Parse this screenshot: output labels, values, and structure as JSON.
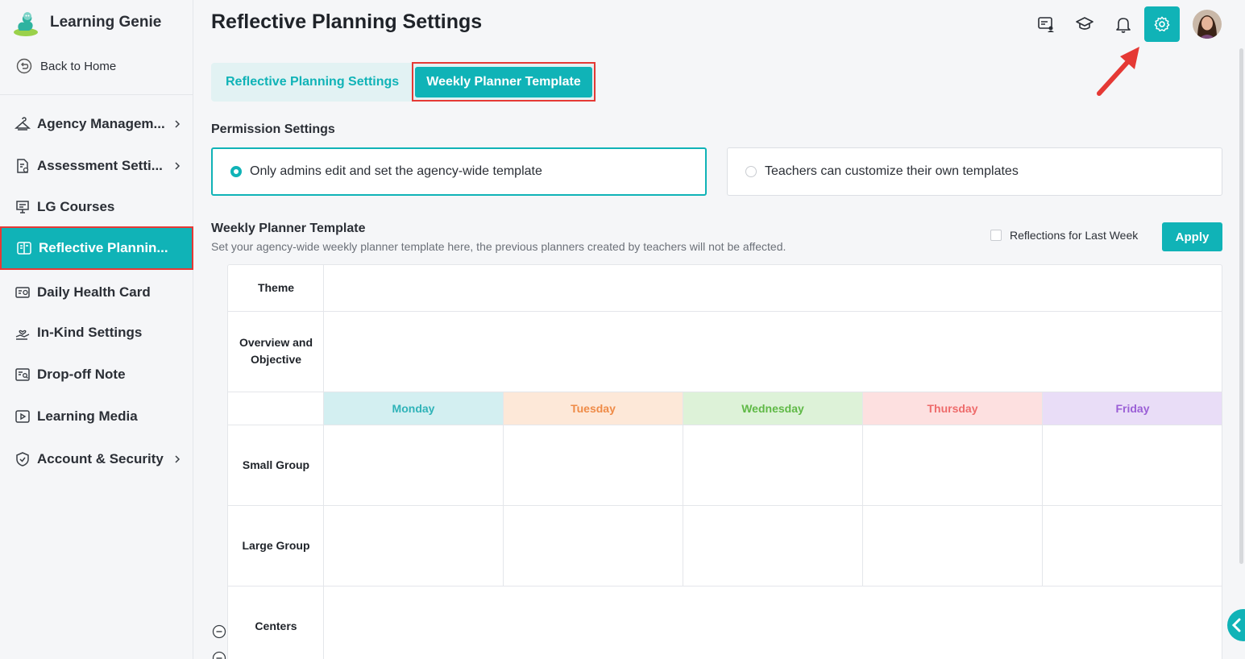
{
  "app": {
    "name": "Learning Genie"
  },
  "sidebar": {
    "back_label": "Back to Home",
    "items": [
      {
        "label": "Agency Managem...",
        "icon": "hanger-icon",
        "has_chevron": true
      },
      {
        "label": "Assessment Setti...",
        "icon": "document-settings-icon",
        "has_chevron": true
      },
      {
        "label": "LG Courses",
        "icon": "presentation-board-icon",
        "has_chevron": false
      },
      {
        "label": "Reflective Plannin...",
        "icon": "book-open-icon",
        "has_chevron": false,
        "active": true
      },
      {
        "label": "Daily Health Card",
        "icon": "health-card-icon",
        "has_chevron": false
      },
      {
        "label": "In-Kind Settings",
        "icon": "hand-heart-icon",
        "has_chevron": false
      },
      {
        "label": "Drop-off Note",
        "icon": "note-search-icon",
        "has_chevron": false
      },
      {
        "label": "Learning Media",
        "icon": "video-play-icon",
        "has_chevron": false
      },
      {
        "label": "Account & Security",
        "icon": "shield-icon",
        "has_chevron": true
      }
    ]
  },
  "header": {
    "title": "Reflective Planning Settings",
    "icons": [
      "chat-user-icon",
      "graduation-cap-icon",
      "bell-icon",
      "gear-icon",
      "avatar"
    ]
  },
  "tabs": {
    "items": [
      "Reflective Planning Settings",
      "Weekly Planner Template"
    ],
    "active_index": 1
  },
  "permission": {
    "title": "Permission Settings",
    "options": [
      {
        "label": "Only admins edit and set the agency-wide template",
        "selected": true
      },
      {
        "label": "Teachers can customize their own templates",
        "selected": false
      }
    ]
  },
  "template": {
    "title": "Weekly Planner Template",
    "description": "Set your agency-wide weekly planner template here, the previous planners created by teachers will not be affected.",
    "checkbox_label": "Reflections for Last Week",
    "checkbox_checked": false,
    "apply_label": "Apply",
    "rows": {
      "theme": "Theme",
      "overview": "Overview and Objective",
      "small_group": "Small Group",
      "large_group": "Large Group",
      "centers": "Centers"
    },
    "days": [
      {
        "name": "Monday",
        "bg": "#d3eff1",
        "fg": "#2fb3b8"
      },
      {
        "name": "Tuesday",
        "bg": "#fde8d8",
        "fg": "#ef8b47"
      },
      {
        "name": "Wednesday",
        "bg": "#ddf2d8",
        "fg": "#5fb946"
      },
      {
        "name": "Thursday",
        "bg": "#fde0e0",
        "fg": "#ee6b6b"
      },
      {
        "name": "Friday",
        "bg": "#e9ddf7",
        "fg": "#9b5fd6"
      }
    ]
  },
  "colors": {
    "accent": "#10b3b7",
    "annotation": "#e53935"
  }
}
